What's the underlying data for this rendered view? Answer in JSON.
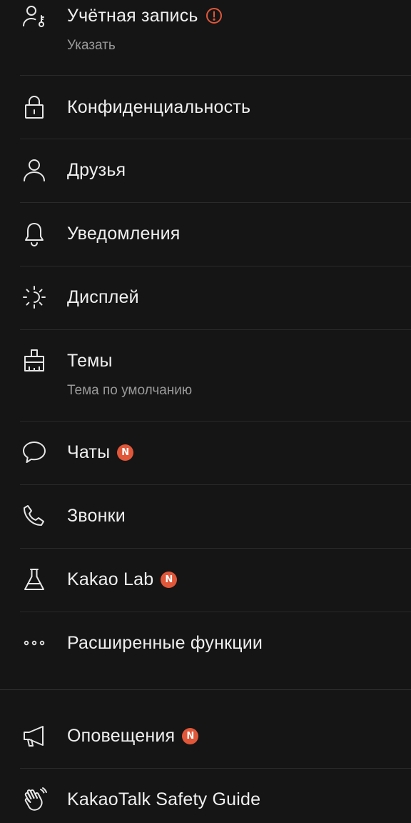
{
  "settings": {
    "items": [
      {
        "label": "Учётная запись",
        "sub": "Указать",
        "icon": "user-key-icon",
        "alert": true
      },
      {
        "label": "Конфиденциальность",
        "icon": "lock-icon"
      },
      {
        "label": "Друзья",
        "icon": "user-icon"
      },
      {
        "label": "Уведомления",
        "icon": "bell-icon"
      },
      {
        "label": "Дисплей",
        "icon": "brightness-icon"
      },
      {
        "label": "Темы",
        "sub": "Тема по умолчанию",
        "icon": "paint-brush-icon"
      },
      {
        "label": "Чаты",
        "icon": "chat-bubble-icon",
        "badge": "N"
      },
      {
        "label": "Звонки",
        "icon": "phone-icon"
      },
      {
        "label": "Kakao Lab",
        "icon": "flask-icon",
        "badge": "N"
      },
      {
        "label": "Расширенные функции",
        "icon": "more-dots-icon"
      }
    ],
    "extra": [
      {
        "label": "Оповещения",
        "icon": "megaphone-icon",
        "badge": "N"
      },
      {
        "label": "KakaoTalk Safety Guide",
        "icon": "hand-wave-icon"
      }
    ]
  },
  "colors": {
    "background": "#151515",
    "text": "#efefef",
    "subtext": "#9a9a9a",
    "badge": "#e0573a",
    "divider": "#2a2a2a"
  }
}
